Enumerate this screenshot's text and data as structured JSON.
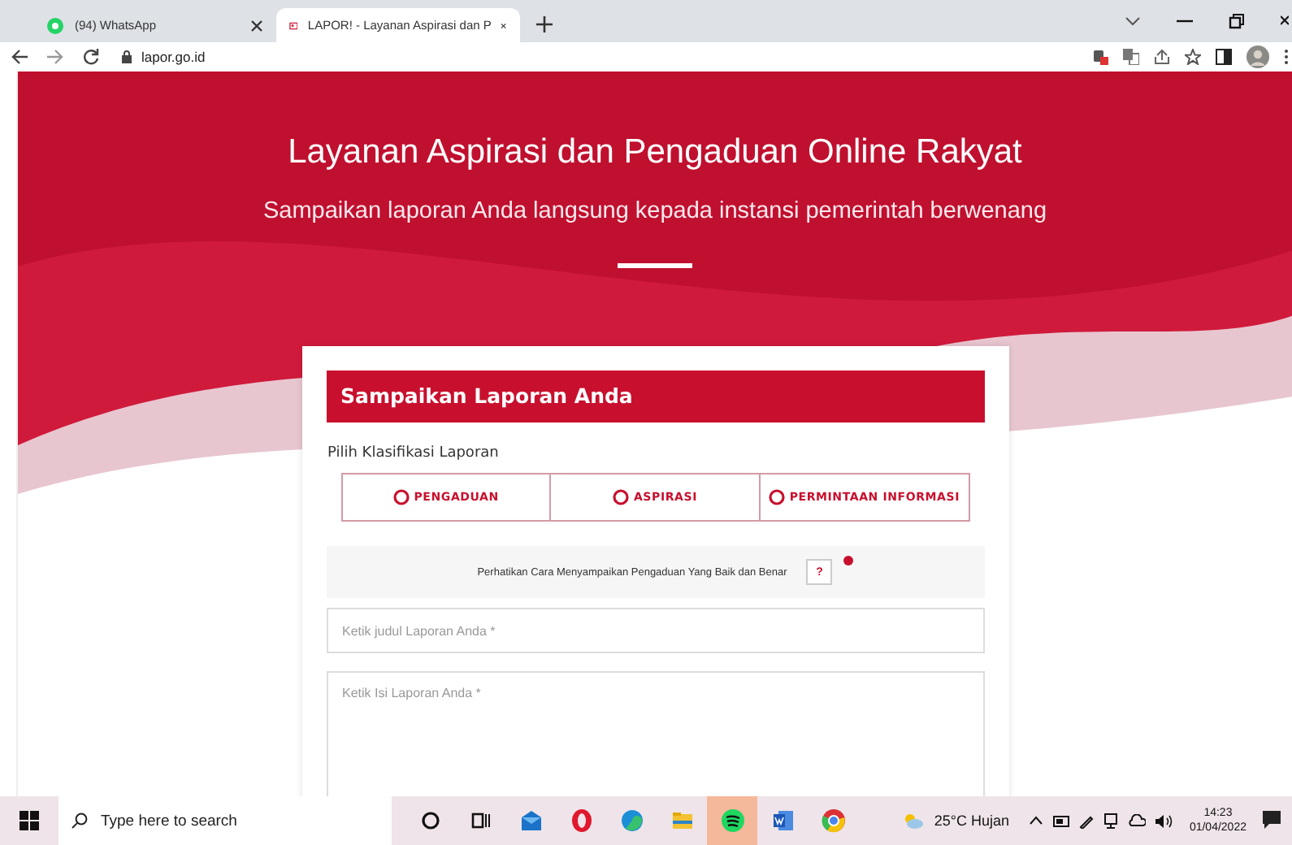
{
  "browser": {
    "tabs": [
      {
        "title": "(94) WhatsApp",
        "kind": "whatsapp",
        "selected": false
      },
      {
        "title": "LAPOR! - Layanan Aspirasi dan P",
        "kind": "lapor",
        "selected": true
      }
    ],
    "address": "lapor.go.id"
  },
  "hero": {
    "title": "Layanan Aspirasi dan Pengaduan Online Rakyat",
    "subtitle": "Sampaikan laporan Anda langsung kepada instansi pemerintah berwenang"
  },
  "form": {
    "heading": "Sampaikan Laporan Anda",
    "classification_label": "Pilih Klasifikasi Laporan",
    "options": [
      {
        "label": "PENGADUAN",
        "selected": false
      },
      {
        "label": "ASPIRASI",
        "selected": false
      },
      {
        "label": "PERMINTAAN INFORMASI",
        "selected": false
      }
    ],
    "notice": "Perhatikan Cara Menyampaikan Pengaduan Yang Baik dan Benar",
    "help_button": "?",
    "title_field": {
      "placeholder": "Ketik judul Laporan Anda *"
    },
    "content_field": {
      "placeholder": "Ketik Isi Laporan Anda *"
    }
  },
  "taskbar": {
    "search_placeholder": "Type here to search",
    "apps": [
      {
        "kind": "cortana",
        "selected": false
      },
      {
        "kind": "taskview",
        "selected": false
      },
      {
        "kind": "mail",
        "selected": false
      },
      {
        "kind": "opera",
        "selected": false
      },
      {
        "kind": "edge",
        "selected": false
      },
      {
        "kind": "files",
        "selected": false
      },
      {
        "kind": "spotify",
        "selected": true
      },
      {
        "kind": "word",
        "selected": false
      },
      {
        "kind": "chrome",
        "selected": false
      }
    ],
    "weather": "25°C Hujan",
    "time": "14:23",
    "date": "01/04/2022"
  }
}
